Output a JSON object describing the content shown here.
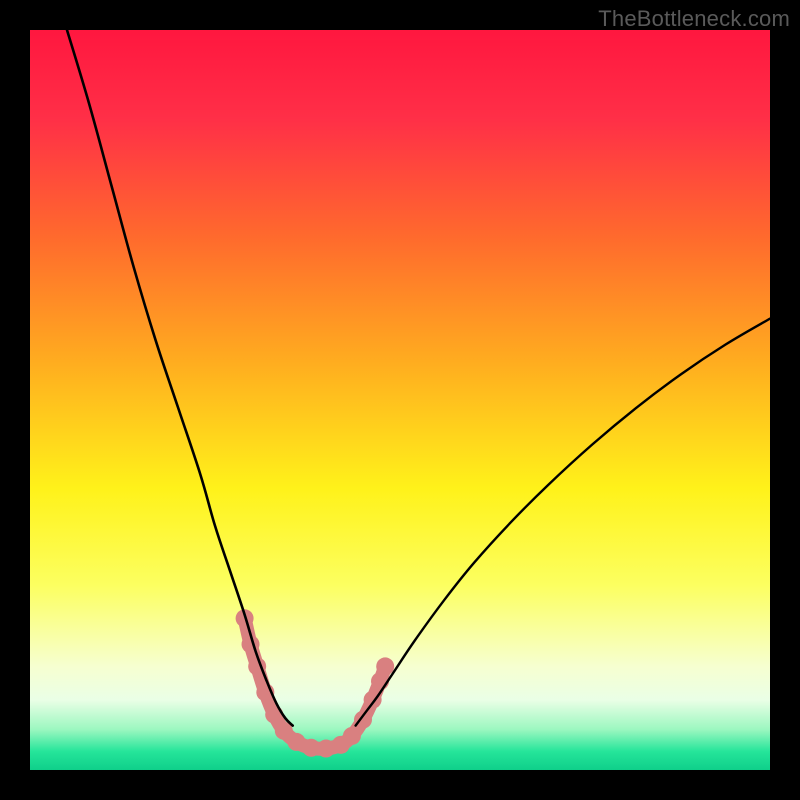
{
  "watermark": "TheBottleneck.com",
  "chart_data": {
    "type": "line",
    "title": "",
    "xlabel": "",
    "ylabel": "",
    "xlim": [
      0,
      100
    ],
    "ylim": [
      0,
      100
    ],
    "background_gradient_stops": [
      {
        "offset": 0,
        "color": "#ff173f"
      },
      {
        "offset": 0.12,
        "color": "#ff2f47"
      },
      {
        "offset": 0.28,
        "color": "#ff6a2d"
      },
      {
        "offset": 0.45,
        "color": "#ffad1f"
      },
      {
        "offset": 0.62,
        "color": "#fff21a"
      },
      {
        "offset": 0.75,
        "color": "#fcff60"
      },
      {
        "offset": 0.86,
        "color": "#f6ffd0"
      },
      {
        "offset": 0.905,
        "color": "#eaffe6"
      },
      {
        "offset": 0.945,
        "color": "#9cf7c0"
      },
      {
        "offset": 0.975,
        "color": "#25e59a"
      },
      {
        "offset": 1.0,
        "color": "#0fcf8a"
      }
    ],
    "series": [
      {
        "name": "left-branch",
        "x": [
          5,
          8,
          11,
          14,
          17,
          20,
          23,
          25,
          27,
          29,
          30.5,
          32,
          33.3,
          34.5,
          35.5
        ],
        "y": [
          100,
          90,
          79,
          68,
          58,
          49,
          40,
          33,
          27,
          21,
          16,
          12,
          9,
          7,
          6
        ]
      },
      {
        "name": "right-branch",
        "x": [
          44,
          45.5,
          47,
          49,
          52,
          56,
          60,
          65,
          70,
          76,
          82,
          88,
          94,
          100
        ],
        "y": [
          6,
          8,
          10,
          13,
          17.5,
          23,
          28,
          33.5,
          38.5,
          44,
          49,
          53.5,
          57.5,
          61
        ]
      },
      {
        "name": "valley-floor-highlight",
        "color": "#d98080",
        "stroke_width": 14,
        "points": [
          {
            "x": 29.0,
            "y": 20.5
          },
          {
            "x": 29.8,
            "y": 17.0
          },
          {
            "x": 30.7,
            "y": 14.0
          },
          {
            "x": 31.8,
            "y": 10.5
          },
          {
            "x": 33.0,
            "y": 7.5
          },
          {
            "x": 34.3,
            "y": 5.3
          },
          {
            "x": 36.0,
            "y": 3.8
          },
          {
            "x": 38.0,
            "y": 3.0
          },
          {
            "x": 40.0,
            "y": 2.9
          },
          {
            "x": 42.0,
            "y": 3.4
          },
          {
            "x": 43.5,
            "y": 4.6
          },
          {
            "x": 45.0,
            "y": 6.8
          },
          {
            "x": 46.3,
            "y": 9.5
          },
          {
            "x": 47.3,
            "y": 12.0
          },
          {
            "x": 48.0,
            "y": 14.0
          }
        ]
      }
    ]
  }
}
